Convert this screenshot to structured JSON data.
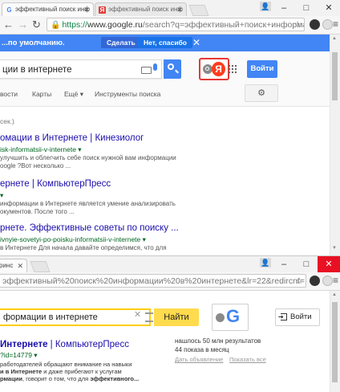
{
  "window1": {
    "tabs": [
      {
        "title": "эффективный поиск инф",
        "favicon": "G"
      },
      {
        "title": "эффективный поиск инф",
        "favicon": "Я"
      }
    ],
    "window_controls": {
      "minimize": "–",
      "maximize": "□",
      "close": "✕"
    },
    "address": {
      "scheme": "https://",
      "host": "www.google.ru",
      "path": "/search?q=эффективный+поиск+информа"
    },
    "banner": {
      "text": "...по умолчанию.",
      "accept": "Сделать",
      "decline": "Нет, спасибо"
    },
    "search": {
      "query": "ции в интернете",
      "login": "Войти"
    },
    "tabs_row": [
      "вости",
      "Карты",
      "Ещё ▾",
      "Инструменты поиска"
    ],
    "stats": "сек.)",
    "results": [
      {
        "title": "омации в Интернете | Кинезиолог",
        "url": "isk-informatsii-v-internete ▾",
        "snippet_1": "улучшить и облегчить себе поиск нужной вам информации",
        "snippet_2": "oogle ?Вот несколько ..."
      },
      {
        "title": "ернете | КомпьютерПресс",
        "url": "▾",
        "snippet_1": "информации в Интернете является умение анализировать",
        "snippet_2": "окументов. После того ..."
      },
      {
        "title": "рнете. Эффективные советы по поиску ...",
        "url": "ivnyie-sovetyi-po-poisku-informatsii-v-internete ▾",
        "snippet_1": "в Интернете Для начала давайте определимся, что для"
      }
    ]
  },
  "window2": {
    "tabs": [
      {
        "title": "ринс",
        "favicon": ""
      }
    ],
    "window_controls": {
      "minimize": "–",
      "maximize": "□",
      "close": "✕"
    },
    "address": {
      "text": "эффективный%20поиск%20информации%20в%20интернете&lr=22&redircnt=14("
    },
    "search": {
      "query": "формации в интернете",
      "clear": "✕",
      "find": "Найти",
      "login": "Войти"
    },
    "result": {
      "title_bold": "Интернете",
      "title_rest": " | КомпьютерПресс",
      "url": "?id=14779 ▾",
      "snippet_1": "работодателей обращают внимание на навыки",
      "snippet_2_bold": "и в Интернете",
      "snippet_2_rest": " и даже прибегают к услугам",
      "snippet_3_bold": "рмации",
      "snippet_3_rest": ", говорит о том, что для ",
      "snippet_3_tail": "эффективного..."
    },
    "right": {
      "results_count": "нашлось 50 млн результатов",
      "impressions": "44 показа в месяц",
      "link_ad": "Дать объявление",
      "link_all": "Показать все"
    }
  },
  "colors": {
    "google_blue": "#4285f4",
    "yandex_red": "#ff3d1c",
    "yandex_yellow": "#ffdb4d",
    "badge_border": "#e53935",
    "link": "#1a0dab",
    "url_green": "#006621"
  },
  "icons": {
    "search": "search-icon",
    "mic": "mic-icon",
    "keyboard": "keyboard-icon",
    "apps": "apps-grid-icon",
    "settings": "gear-icon",
    "menu": "menu-icon"
  }
}
